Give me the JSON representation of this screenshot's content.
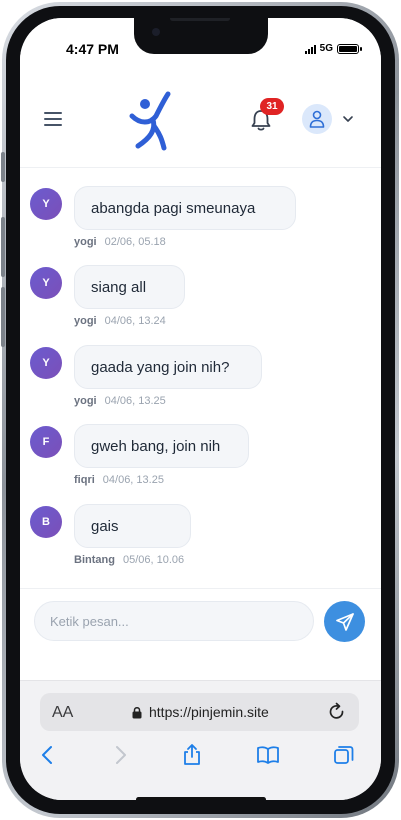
{
  "status_bar": {
    "time": "4:47 PM",
    "network": "5G"
  },
  "header": {
    "notification_count": "31"
  },
  "messages": [
    {
      "initial": "Y",
      "text": "abangda pagi smeunaya",
      "sender": "yogi",
      "timestamp": "02/06, 05.18"
    },
    {
      "initial": "Y",
      "text": "siang all",
      "sender": "yogi",
      "timestamp": "04/06, 13.24"
    },
    {
      "initial": "Y",
      "text": "gaada yang join nih?",
      "sender": "yogi",
      "timestamp": "04/06, 13.25"
    },
    {
      "initial": "F",
      "text": "gweh bang, join nih",
      "sender": "fiqri",
      "timestamp": "04/06, 13.25"
    },
    {
      "initial": "B",
      "text": "gais",
      "sender": "Bintang",
      "timestamp": "05/06, 10.06"
    }
  ],
  "composer": {
    "placeholder": "Ketik pesan..."
  },
  "browser": {
    "text_size_label": "AA",
    "url": "https://pinjemin.site"
  },
  "colors": {
    "accent": "#3d8fe0",
    "avatar": "#6b5ccf",
    "badge": "#e02424",
    "logo": "#2f5fd6"
  },
  "icons": [
    "menu-icon",
    "logo-icon",
    "bell-icon",
    "user-icon",
    "chevron-down-icon",
    "send-icon",
    "lock-icon",
    "reload-icon",
    "back-icon",
    "forward-icon",
    "share-icon",
    "bookmarks-icon",
    "tabs-icon"
  ]
}
